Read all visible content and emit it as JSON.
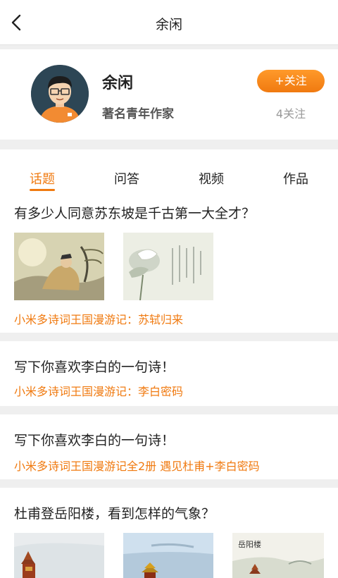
{
  "header": {
    "title": "余闲"
  },
  "profile": {
    "name": "余闲",
    "title": "著名青年作家",
    "follow_label": "+关注",
    "follow_count": "4关注"
  },
  "tabs": [
    {
      "label": "话题",
      "active": true
    },
    {
      "label": "问答",
      "active": false
    },
    {
      "label": "视频",
      "active": false
    },
    {
      "label": "作品",
      "active": false
    }
  ],
  "posts": [
    {
      "title": "有多少人同意苏东坡是千古第一大全才？",
      "link": "小米多诗词王国漫游记：苏轼归来"
    },
    {
      "title": "写下你喜欢李白的一句诗！",
      "link": "小米多诗词王国漫游记：李白密码"
    },
    {
      "title": "写下你喜欢李白的一句诗！",
      "link": "小米多诗词王国漫游记全2册 遇见杜甫+李白密码"
    },
    {
      "title": "杜甫登岳阳楼，看到怎样的气象？"
    }
  ],
  "image_caption": "岳阳楼",
  "colors": {
    "accent": "#f07a10",
    "text": "#222222",
    "muted": "#999999"
  }
}
